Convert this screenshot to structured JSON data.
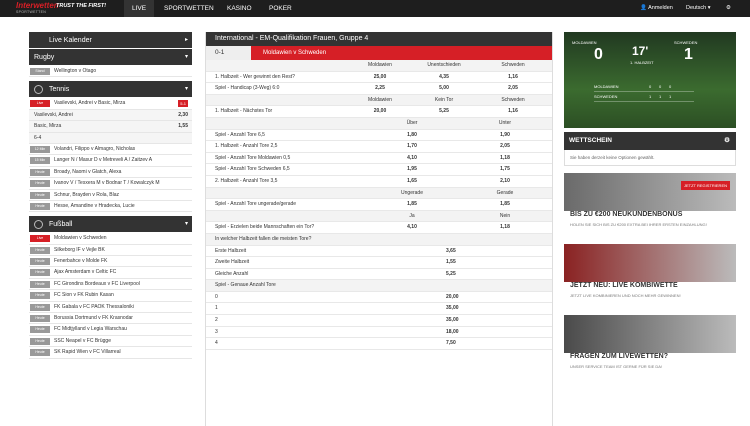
{
  "logo": {
    "brand": "Interwetten",
    "slogan": "TRUST THE FIRST!",
    "sub": "SPORTWETTEN"
  },
  "nav": [
    {
      "label": "LIVE"
    },
    {
      "label": "SPORTWETTEN"
    },
    {
      "label": "KASINO"
    },
    {
      "label": "POKER"
    }
  ],
  "topright": {
    "login": "Anmelden",
    "lang": "Deutsch",
    "gear": "gear-icon"
  },
  "sidebar": {
    "live_title": "Live Kalender",
    "rugby": {
      "title": "Rugby",
      "rows": [
        {
          "time": "Stand",
          "name": "Wellington v Otago"
        }
      ]
    },
    "tennis": {
      "title": "Tennis",
      "rows": [
        {
          "time": "Live",
          "name": "Vasilevski, Andrei v Basic, Mirza",
          "score": "5-1"
        },
        {
          "time": "",
          "name": "Vasilevski, Andrei",
          "odds": "2,30"
        },
        {
          "time": "",
          "name": "Basic, Mirza",
          "odds": "1,55"
        },
        {
          "time": "",
          "name": "6-4",
          "odds": ""
        },
        {
          "time": "12 Min",
          "name": "Volandri, Filippo v Almagro, Nicholas"
        },
        {
          "time": "15 Min",
          "name": "Langer N / Masur D v Metreveli A / Zaitzev A"
        },
        {
          "time": "Heute",
          "name": "Broady, Naomi v Glatch, Alexa"
        },
        {
          "time": "Heute",
          "name": "Ivanov V / Tesxera M v Bodnar T / Kowalczyk M"
        },
        {
          "time": "Heute",
          "name": "Schnur, Brayden v Rola, Blaz"
        },
        {
          "time": "Heute",
          "name": "Hesse, Amandine v Hradecka, Lucie"
        }
      ]
    },
    "football": {
      "title": "Fußball",
      "rows": [
        {
          "time": "Live",
          "name": "Moldawien v Schweden"
        },
        {
          "time": "Heute",
          "name": "Silkeborg IF v Vejle BK"
        },
        {
          "time": "Heute",
          "name": "Fenerbahce v Molde FK"
        },
        {
          "time": "Heute",
          "name": "Ajax Amsterdam v Celtic FC"
        },
        {
          "time": "Heute",
          "name": "FC Girondins Bordeaux v FC Liverpool"
        },
        {
          "time": "Heute",
          "name": "FC Sion v FK Rubin Kasan"
        },
        {
          "time": "Heute",
          "name": "FK Gabala v FC PAOK Thessaloniki"
        },
        {
          "time": "Heute",
          "name": "Borussia Dortmund v FK Krasnodar"
        },
        {
          "time": "Heute",
          "name": "FC Midtjylland v Legia Warschau"
        },
        {
          "time": "Heute",
          "name": "SSC Neapel v FC Brügge"
        },
        {
          "time": "Heute",
          "name": "SK Rapid Wien v FC Villarreal"
        }
      ]
    }
  },
  "main": {
    "title": "International - EM-Qualifikation Frauen, Gruppe 4",
    "score": "0-1",
    "match": "Moldawien v Schweden",
    "markets": [
      {
        "type": "h3",
        "cols": [
          "Moldawien",
          "Unentschieden",
          "Schweden"
        ]
      },
      {
        "type": "r3",
        "label": "1. Halbzeit - Wer gewinnt den Rest?",
        "v": [
          "25,00",
          "4,35",
          "1,16"
        ]
      },
      {
        "type": "r3",
        "label": "Spiel - Handicap (3-Weg) 6:0",
        "v": [
          "2,25",
          "5,00",
          "2,05"
        ]
      },
      {
        "type": "h3",
        "cols": [
          "Moldawien",
          "Kein Tor",
          "Schweden"
        ]
      },
      {
        "type": "r3",
        "label": "1. Halbzeit - Nächstes Tor",
        "v": [
          "20,00",
          "5,25",
          "1,16"
        ]
      },
      {
        "type": "h2",
        "cols": [
          "Über",
          "Unter"
        ]
      },
      {
        "type": "r2",
        "label": "Spiel - Anzahl Tore 6,5",
        "v": [
          "1,80",
          "1,90"
        ]
      },
      {
        "type": "r2",
        "label": "1. Halbzeit - Anzahl Tore 2,5",
        "v": [
          "1,70",
          "2,05"
        ]
      },
      {
        "type": "r2",
        "label": "Spiel - Anzahl Tore Moldawien 0,5",
        "v": [
          "4,10",
          "1,18"
        ]
      },
      {
        "type": "r2",
        "label": "Spiel - Anzahl Tore Schweden 6,5",
        "v": [
          "1,95",
          "1,75"
        ]
      },
      {
        "type": "r2",
        "label": "2. Halbzeit - Anzahl Tore 3,5",
        "v": [
          "1,65",
          "2,10"
        ]
      },
      {
        "type": "h2",
        "cols": [
          "Ungerade",
          "Gerade"
        ]
      },
      {
        "type": "r2",
        "label": "Spiel - Anzahl Tore ungerade/gerade",
        "v": [
          "1,85",
          "1,85"
        ]
      },
      {
        "type": "h2",
        "cols": [
          "Ja",
          "Nein"
        ]
      },
      {
        "type": "r2",
        "label": "Spiel - Erzielen beide Mannschaften ein Tor?",
        "v": [
          "4,10",
          "1,18"
        ]
      },
      {
        "type": "h1",
        "label": "In welcher Halbzeit fallen die meisten Tore?"
      },
      {
        "type": "r1",
        "label": "Erste Halbzeit",
        "v": "3,65"
      },
      {
        "type": "r1",
        "label": "Zweite Halbzeit",
        "v": "1,55"
      },
      {
        "type": "r1",
        "label": "Gleiche Anzahl",
        "v": "5,25"
      },
      {
        "type": "h1",
        "label": "Spiel - Genaue Anzahl Tore"
      },
      {
        "type": "r1",
        "label": "0",
        "v": "20,00"
      },
      {
        "type": "r1",
        "label": "1",
        "v": "35,00"
      },
      {
        "type": "r1",
        "label": "2",
        "v": "35,00"
      },
      {
        "type": "r1",
        "label": "3",
        "v": "18,00"
      },
      {
        "type": "r1",
        "label": "4",
        "v": "7,50"
      }
    ]
  },
  "live": {
    "home": "MOLDAWIEN",
    "away": "SCHWEDEN",
    "home_score": "0",
    "away_score": "1",
    "minute": "17'",
    "half": "1. HALBZEIT",
    "stats": [
      {
        "team": "MOLDAWIEN",
        "a": "0",
        "b": "0",
        "c": "0"
      },
      {
        "team": "SCHWEDEN",
        "a": "1",
        "b": "1",
        "c": "1"
      }
    ]
  },
  "betslip": {
    "title": "WETTSCHEIN",
    "empty": "Sie haben derzeit keine Optionen gewählt."
  },
  "banners": [
    {
      "title": "BIS ZU €200 NEUKUNDENBONUS",
      "text": "HOLEN SIE SICH BIS ZU €200 EXTRA BEI IHRER ERSTEN EINZAHLUNG!",
      "button": "JETZT REGISTRIEREN"
    },
    {
      "title": "JETZT NEU: LIVE KOMBIWETTE",
      "text": "JETZT LIVE KOMBINIEREN UND NOCH MEHR GEWINNEN!"
    },
    {
      "title": "FRAGEN ZUM LIVEWETTEN?",
      "text": "UNSER SERVICE TEAM IST GERNE FÜR SIE DA!"
    }
  ]
}
